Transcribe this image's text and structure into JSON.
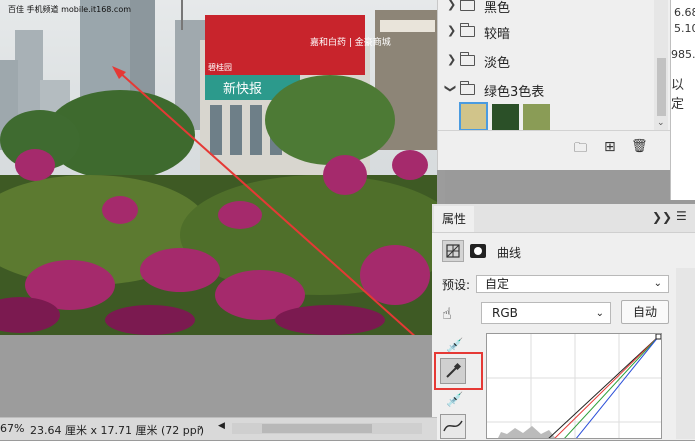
{
  "watermark": "百佳  手机频道  mobile.it168.com",
  "photo": {
    "billboard_sign": "新快报",
    "billboard_top": "嘉和白药 | 金豪商城",
    "billboard_left": "碧桂园"
  },
  "swatches": {
    "folders": [
      {
        "label": "黑色",
        "expanded": false
      },
      {
        "label": "较暗",
        "expanded": false
      },
      {
        "label": "淡色",
        "expanded": false
      },
      {
        "label": "绿色3色表",
        "expanded": true
      }
    ],
    "colors": [
      "#d1c48a",
      "#2b5028",
      "#8a9c56"
    ],
    "selected_index": 0
  },
  "right_sliver": {
    "line1": "6.68",
    "line2": "5.10",
    "line3": "985.4",
    "line4": "以定"
  },
  "properties": {
    "tab_label": "属性",
    "curves_label": "曲线",
    "preset_label": "预设:",
    "preset_value": "自定",
    "channel_value": "RGB",
    "auto_button": "自动"
  },
  "statusbar": {
    "zoom": "67%",
    "doc_size": "23.64 厘米 x 17.71 厘米 (72 ppi)",
    "arrow": "›"
  },
  "colors": {
    "annotation_red": "#e53935",
    "highlight_box": "#e53935"
  }
}
